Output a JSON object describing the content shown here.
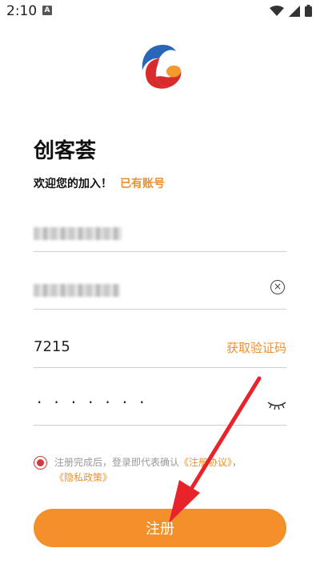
{
  "status_bar": {
    "time": "2:10",
    "notification_badge": "A"
  },
  "app": {
    "title": "创客荟",
    "welcome": "欢迎您的加入！",
    "has_account_link": "已有账号"
  },
  "form": {
    "phone": {
      "value": ""
    },
    "email": {
      "value": ""
    },
    "verify_code": {
      "value": "7215",
      "get_code_label": "获取验证码"
    },
    "password": {
      "masked_value": "·······"
    }
  },
  "agreement": {
    "text_before": "注册完成后，登录即代表确认",
    "user_agreement_link": "《注册协议》",
    "separator": "，",
    "privacy_link": "《隐私政策》",
    "checked": true
  },
  "register_button": {
    "label": "注册"
  },
  "colors": {
    "accent": "#f3902a",
    "radio": "#d23a3a",
    "arrow": "#e8242a",
    "logo_blue": "#2a66b8",
    "logo_red": "#d92b2b"
  },
  "icons": [
    "wifi-icon",
    "signal-icon",
    "battery-icon",
    "clear-icon",
    "eye-closed-icon",
    "app-logo"
  ]
}
